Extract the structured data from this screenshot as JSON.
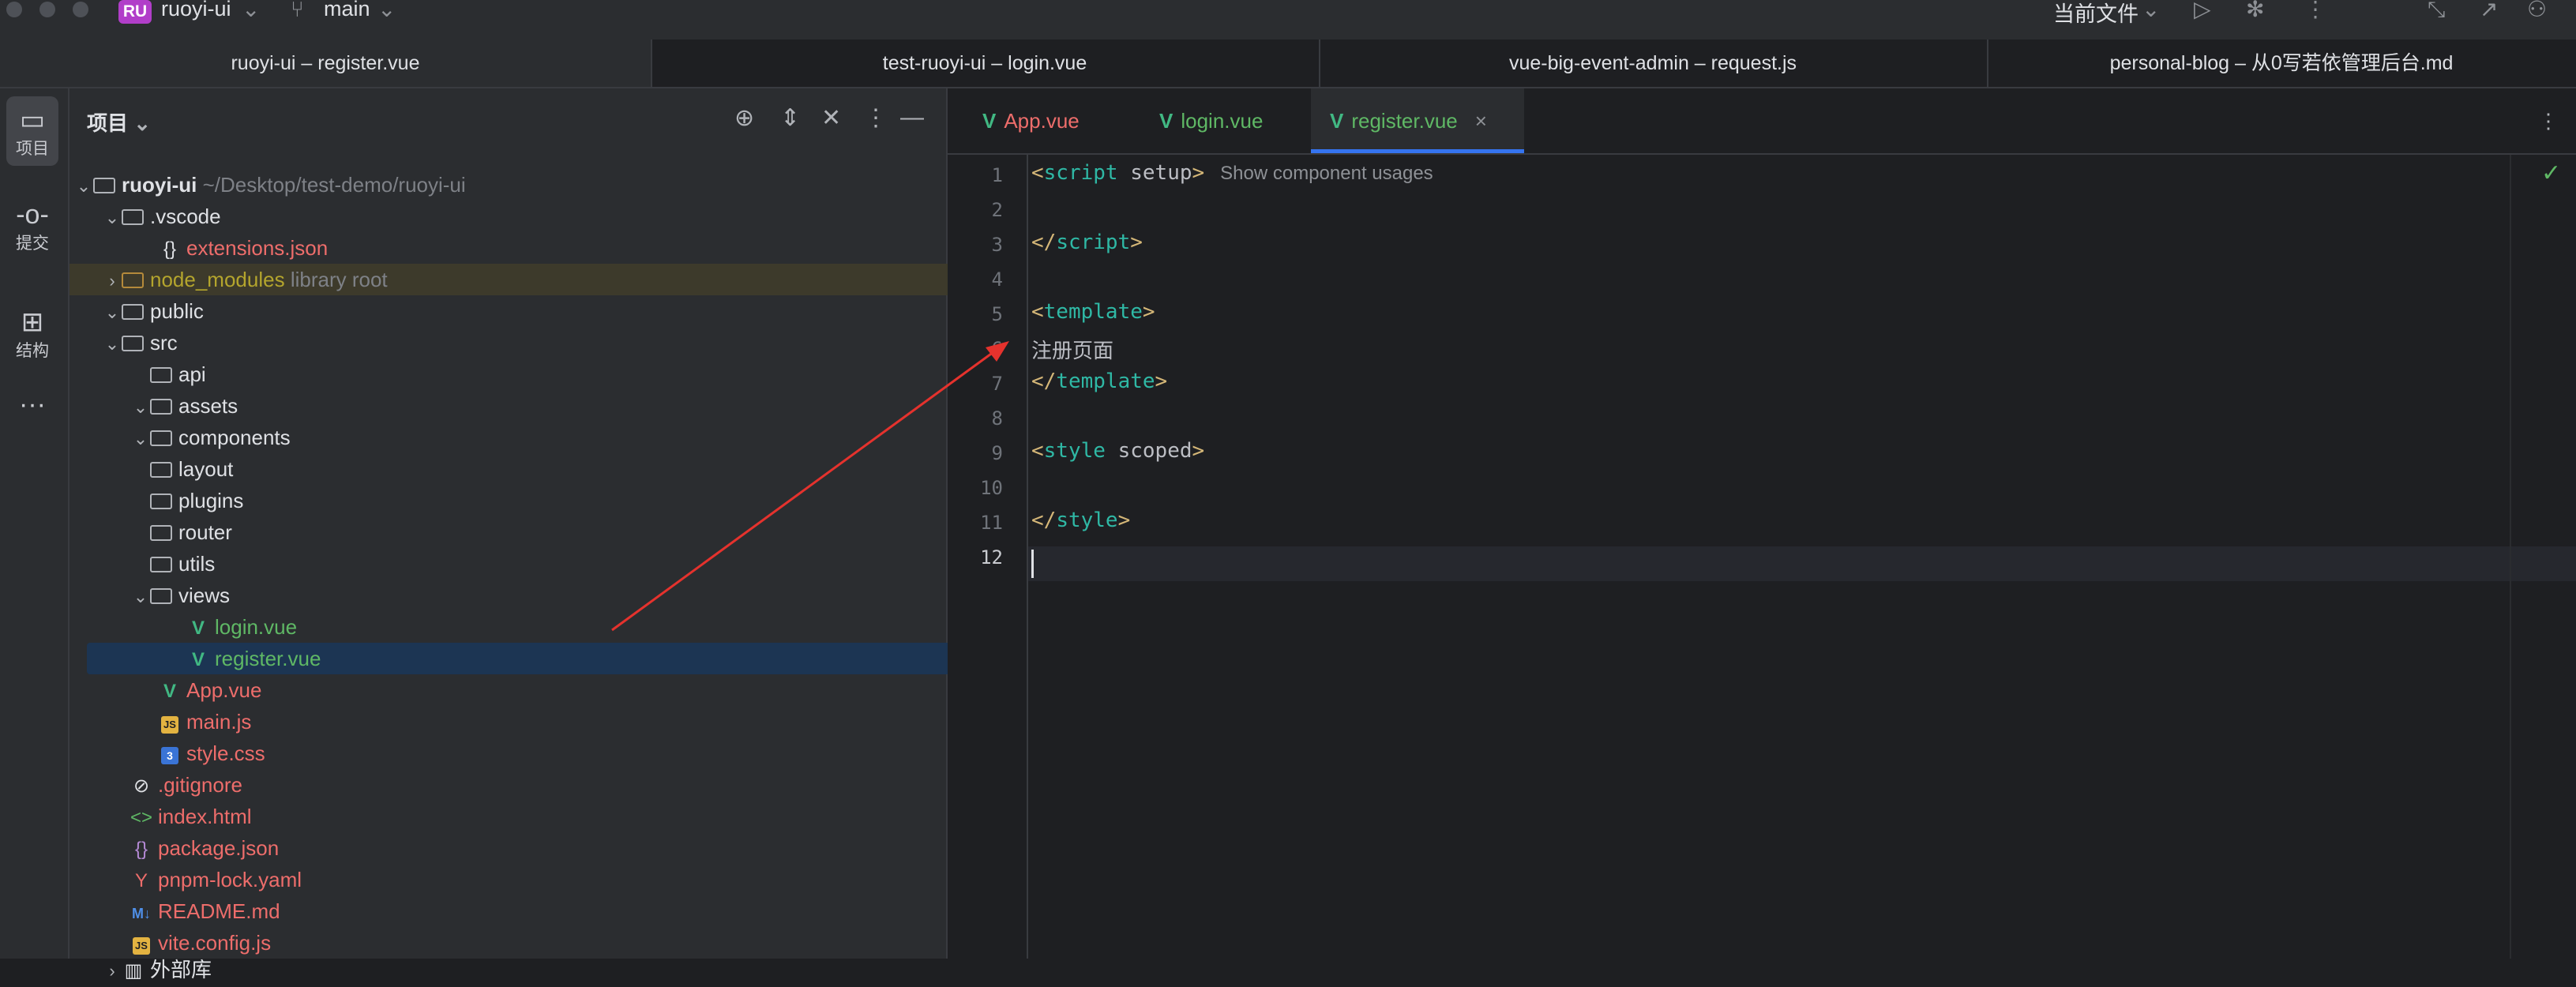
{
  "titlebar": {
    "project_badge": "RU",
    "project_name": "ruoyi-ui",
    "branch_name": "main",
    "run_config": "当前文件"
  },
  "window_tabs": [
    "ruoyi-ui – register.vue",
    "test-ruoyi-ui – login.vue",
    "vue-big-event-admin – request.js",
    "personal-blog – 从0写若依管理后台.md"
  ],
  "toolstrip": [
    {
      "label": "项目",
      "icon": "folder-icon"
    },
    {
      "label": "提交",
      "icon": "commit-icon"
    },
    {
      "label": "结构",
      "icon": "structure-icon"
    },
    {
      "label": "",
      "icon": "more-icon"
    }
  ],
  "project_panel": {
    "title": "项目",
    "tree": [
      {
        "name": "ruoyi-ui",
        "hint": "~/Desktop/test-demo/ruoyi-ui"
      },
      {
        "name": ".vscode"
      },
      {
        "name": "extensions.json"
      },
      {
        "name": "node_modules",
        "hint": "library root"
      },
      {
        "name": "public"
      },
      {
        "name": "src"
      },
      {
        "name": "api"
      },
      {
        "name": "assets"
      },
      {
        "name": "components"
      },
      {
        "name": "layout"
      },
      {
        "name": "plugins"
      },
      {
        "name": "router"
      },
      {
        "name": "utils"
      },
      {
        "name": "views"
      },
      {
        "name": "login.vue"
      },
      {
        "name": "register.vue"
      },
      {
        "name": "App.vue"
      },
      {
        "name": "main.js"
      },
      {
        "name": "style.css"
      },
      {
        "name": ".gitignore"
      },
      {
        "name": "index.html"
      },
      {
        "name": "package.json"
      },
      {
        "name": "pnpm-lock.yaml"
      },
      {
        "name": "README.md"
      },
      {
        "name": "vite.config.js"
      },
      {
        "name": "外部库"
      }
    ]
  },
  "editor": {
    "tabs": [
      "App.vue",
      "login.vue",
      "register.vue"
    ],
    "active_tab": "register.vue",
    "line_numbers": [
      "1",
      "2",
      "3",
      "4",
      "5",
      "6",
      "7",
      "8",
      "9",
      "10",
      "11",
      "12"
    ],
    "inlay_hint": "Show component usages",
    "code": {
      "l1_open": "<",
      "l1_tag": "script",
      "l1_attr": " setup",
      "l1_close": ">",
      "l3_open": "</",
      "l3_tag": "script",
      "l3_close": ">",
      "l5_open": "<",
      "l5_tag": "template",
      "l5_close": ">",
      "l6_text": "注册页面",
      "l7_open": "</",
      "l7_tag": "template",
      "l7_close": ">",
      "l9_open": "<",
      "l9_tag": "style",
      "l9_attr": " scoped",
      "l9_close": ">",
      "l11_open": "</",
      "l11_tag": "style",
      "l11_close": ">"
    }
  },
  "annotation": {
    "color": "#e5322d"
  }
}
